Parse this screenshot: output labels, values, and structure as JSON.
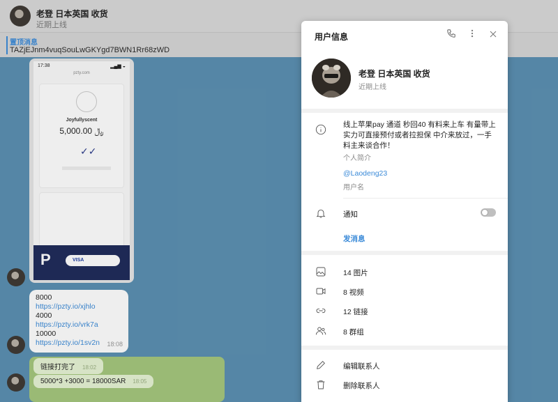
{
  "chat": {
    "title": "老登 日本英国 收货",
    "status": "近期上线",
    "pinned_label": "置顶消息",
    "pinned_text": "TAZjEJnm4vuqSouLwGKYgd7BWN1Rr68zWD"
  },
  "photo": {
    "status_time": "17:38",
    "url": "pzty.com",
    "merchant": "Joyfullyscent",
    "amount": "5,000.00 ﷼",
    "pay_brand": "VISA"
  },
  "messages": {
    "m1": {
      "lines": [
        "8000",
        "https://pzty.io/xjhlo",
        " 4000",
        "https://pzty.io/vrk7a",
        " 10000",
        "https://pzty.io/1sv2n"
      ],
      "time": "18:08"
    },
    "m2": {
      "text": "链接打完了",
      "time": "18:02"
    },
    "m3": {
      "text": "5000*3  +3000 = 18000SAR",
      "time": "18:05"
    }
  },
  "panel": {
    "title": "用户信息",
    "name": "老登 日本英国 收货",
    "status": "近期上线",
    "bio": "线上苹果pay 通道 秒回40 有料来上车 有量带上实力可直接预付或者拉担保 中介来放过，一手料主来谈合作！",
    "bio_label": "个人简介",
    "username": "@Laodeng23",
    "username_label": "用户名",
    "notifications": "通知",
    "send_message": "发消息",
    "media": {
      "photos": "14 图片",
      "videos": "8 视频",
      "links": "12 链接",
      "groups": "8 群组"
    },
    "edit_contact": "编辑联系人",
    "delete_contact": "删除联系人"
  }
}
